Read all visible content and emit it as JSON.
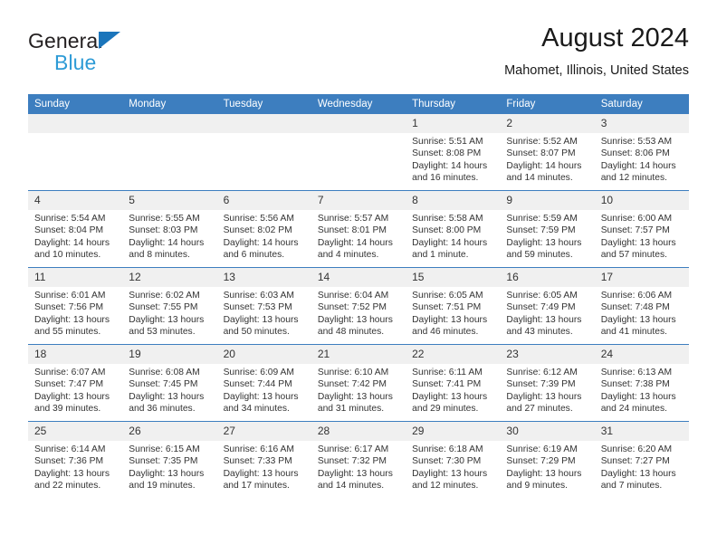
{
  "brand": {
    "name_part1": "General",
    "name_part2": "Blue",
    "triangle_color": "#1b75bb",
    "blue_text_color": "#2e9bd6"
  },
  "header": {
    "title": "August 2024",
    "subtitle": "Mahomet, Illinois, United States"
  },
  "theme": {
    "header_row_bg": "#3d7ebf",
    "daynum_bg": "#f0f0f0",
    "grid_line": "#3d7ebf",
    "text": "#333333"
  },
  "labels": {
    "sunrise": "Sunrise:",
    "sunset": "Sunset:",
    "daylight": "Daylight:"
  },
  "weekdays": [
    "Sunday",
    "Monday",
    "Tuesday",
    "Wednesday",
    "Thursday",
    "Friday",
    "Saturday"
  ],
  "weeks": [
    [
      {
        "day": ""
      },
      {
        "day": ""
      },
      {
        "day": ""
      },
      {
        "day": ""
      },
      {
        "day": "1",
        "sunrise": "Sunrise: 5:51 AM",
        "sunset": "Sunset: 8:08 PM",
        "daylight_line1": "Daylight: 14 hours",
        "daylight_line2": "and 16 minutes."
      },
      {
        "day": "2",
        "sunrise": "Sunrise: 5:52 AM",
        "sunset": "Sunset: 8:07 PM",
        "daylight_line1": "Daylight: 14 hours",
        "daylight_line2": "and 14 minutes."
      },
      {
        "day": "3",
        "sunrise": "Sunrise: 5:53 AM",
        "sunset": "Sunset: 8:06 PM",
        "daylight_line1": "Daylight: 14 hours",
        "daylight_line2": "and 12 minutes."
      }
    ],
    [
      {
        "day": "4",
        "sunrise": "Sunrise: 5:54 AM",
        "sunset": "Sunset: 8:04 PM",
        "daylight_line1": "Daylight: 14 hours",
        "daylight_line2": "and 10 minutes."
      },
      {
        "day": "5",
        "sunrise": "Sunrise: 5:55 AM",
        "sunset": "Sunset: 8:03 PM",
        "daylight_line1": "Daylight: 14 hours",
        "daylight_line2": "and 8 minutes."
      },
      {
        "day": "6",
        "sunrise": "Sunrise: 5:56 AM",
        "sunset": "Sunset: 8:02 PM",
        "daylight_line1": "Daylight: 14 hours",
        "daylight_line2": "and 6 minutes."
      },
      {
        "day": "7",
        "sunrise": "Sunrise: 5:57 AM",
        "sunset": "Sunset: 8:01 PM",
        "daylight_line1": "Daylight: 14 hours",
        "daylight_line2": "and 4 minutes."
      },
      {
        "day": "8",
        "sunrise": "Sunrise: 5:58 AM",
        "sunset": "Sunset: 8:00 PM",
        "daylight_line1": "Daylight: 14 hours",
        "daylight_line2": "and 1 minute."
      },
      {
        "day": "9",
        "sunrise": "Sunrise: 5:59 AM",
        "sunset": "Sunset: 7:59 PM",
        "daylight_line1": "Daylight: 13 hours",
        "daylight_line2": "and 59 minutes."
      },
      {
        "day": "10",
        "sunrise": "Sunrise: 6:00 AM",
        "sunset": "Sunset: 7:57 PM",
        "daylight_line1": "Daylight: 13 hours",
        "daylight_line2": "and 57 minutes."
      }
    ],
    [
      {
        "day": "11",
        "sunrise": "Sunrise: 6:01 AM",
        "sunset": "Sunset: 7:56 PM",
        "daylight_line1": "Daylight: 13 hours",
        "daylight_line2": "and 55 minutes."
      },
      {
        "day": "12",
        "sunrise": "Sunrise: 6:02 AM",
        "sunset": "Sunset: 7:55 PM",
        "daylight_line1": "Daylight: 13 hours",
        "daylight_line2": "and 53 minutes."
      },
      {
        "day": "13",
        "sunrise": "Sunrise: 6:03 AM",
        "sunset": "Sunset: 7:53 PM",
        "daylight_line1": "Daylight: 13 hours",
        "daylight_line2": "and 50 minutes."
      },
      {
        "day": "14",
        "sunrise": "Sunrise: 6:04 AM",
        "sunset": "Sunset: 7:52 PM",
        "daylight_line1": "Daylight: 13 hours",
        "daylight_line2": "and 48 minutes."
      },
      {
        "day": "15",
        "sunrise": "Sunrise: 6:05 AM",
        "sunset": "Sunset: 7:51 PM",
        "daylight_line1": "Daylight: 13 hours",
        "daylight_line2": "and 46 minutes."
      },
      {
        "day": "16",
        "sunrise": "Sunrise: 6:05 AM",
        "sunset": "Sunset: 7:49 PM",
        "daylight_line1": "Daylight: 13 hours",
        "daylight_line2": "and 43 minutes."
      },
      {
        "day": "17",
        "sunrise": "Sunrise: 6:06 AM",
        "sunset": "Sunset: 7:48 PM",
        "daylight_line1": "Daylight: 13 hours",
        "daylight_line2": "and 41 minutes."
      }
    ],
    [
      {
        "day": "18",
        "sunrise": "Sunrise: 6:07 AM",
        "sunset": "Sunset: 7:47 PM",
        "daylight_line1": "Daylight: 13 hours",
        "daylight_line2": "and 39 minutes."
      },
      {
        "day": "19",
        "sunrise": "Sunrise: 6:08 AM",
        "sunset": "Sunset: 7:45 PM",
        "daylight_line1": "Daylight: 13 hours",
        "daylight_line2": "and 36 minutes."
      },
      {
        "day": "20",
        "sunrise": "Sunrise: 6:09 AM",
        "sunset": "Sunset: 7:44 PM",
        "daylight_line1": "Daylight: 13 hours",
        "daylight_line2": "and 34 minutes."
      },
      {
        "day": "21",
        "sunrise": "Sunrise: 6:10 AM",
        "sunset": "Sunset: 7:42 PM",
        "daylight_line1": "Daylight: 13 hours",
        "daylight_line2": "and 31 minutes."
      },
      {
        "day": "22",
        "sunrise": "Sunrise: 6:11 AM",
        "sunset": "Sunset: 7:41 PM",
        "daylight_line1": "Daylight: 13 hours",
        "daylight_line2": "and 29 minutes."
      },
      {
        "day": "23",
        "sunrise": "Sunrise: 6:12 AM",
        "sunset": "Sunset: 7:39 PM",
        "daylight_line1": "Daylight: 13 hours",
        "daylight_line2": "and 27 minutes."
      },
      {
        "day": "24",
        "sunrise": "Sunrise: 6:13 AM",
        "sunset": "Sunset: 7:38 PM",
        "daylight_line1": "Daylight: 13 hours",
        "daylight_line2": "and 24 minutes."
      }
    ],
    [
      {
        "day": "25",
        "sunrise": "Sunrise: 6:14 AM",
        "sunset": "Sunset: 7:36 PM",
        "daylight_line1": "Daylight: 13 hours",
        "daylight_line2": "and 22 minutes."
      },
      {
        "day": "26",
        "sunrise": "Sunrise: 6:15 AM",
        "sunset": "Sunset: 7:35 PM",
        "daylight_line1": "Daylight: 13 hours",
        "daylight_line2": "and 19 minutes."
      },
      {
        "day": "27",
        "sunrise": "Sunrise: 6:16 AM",
        "sunset": "Sunset: 7:33 PM",
        "daylight_line1": "Daylight: 13 hours",
        "daylight_line2": "and 17 minutes."
      },
      {
        "day": "28",
        "sunrise": "Sunrise: 6:17 AM",
        "sunset": "Sunset: 7:32 PM",
        "daylight_line1": "Daylight: 13 hours",
        "daylight_line2": "and 14 minutes."
      },
      {
        "day": "29",
        "sunrise": "Sunrise: 6:18 AM",
        "sunset": "Sunset: 7:30 PM",
        "daylight_line1": "Daylight: 13 hours",
        "daylight_line2": "and 12 minutes."
      },
      {
        "day": "30",
        "sunrise": "Sunrise: 6:19 AM",
        "sunset": "Sunset: 7:29 PM",
        "daylight_line1": "Daylight: 13 hours",
        "daylight_line2": "and 9 minutes."
      },
      {
        "day": "31",
        "sunrise": "Sunrise: 6:20 AM",
        "sunset": "Sunset: 7:27 PM",
        "daylight_line1": "Daylight: 13 hours",
        "daylight_line2": "and 7 minutes."
      }
    ]
  ]
}
